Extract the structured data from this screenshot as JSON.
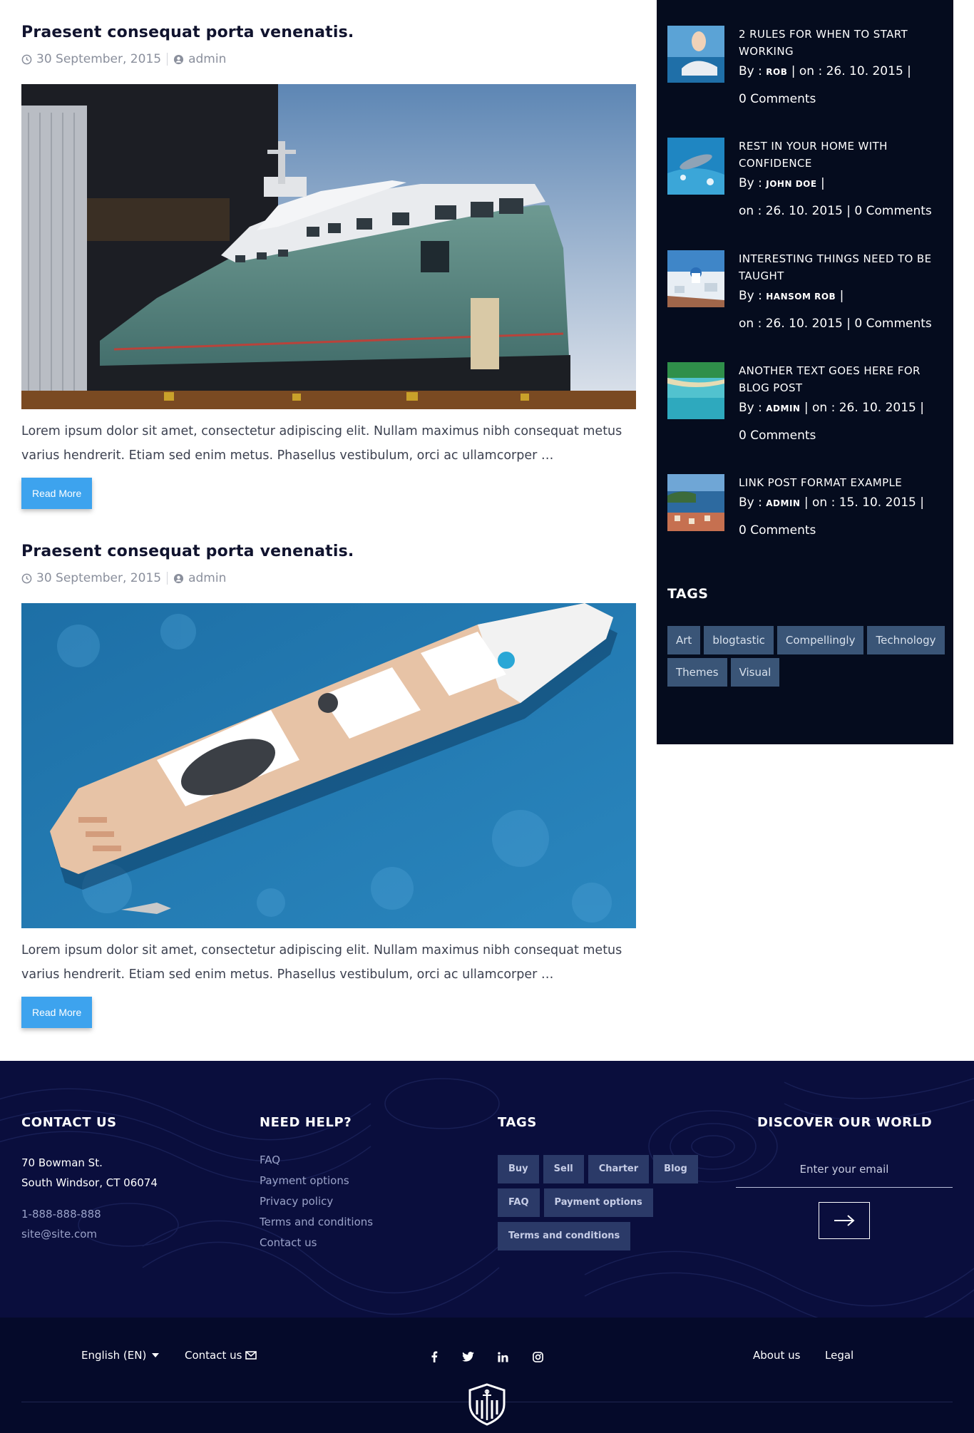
{
  "posts": [
    {
      "title": "Praesent consequat porta venenatis.",
      "date": "30 September, 2015",
      "author": "admin",
      "excerpt": "Lorem ipsum dolor sit amet, consectetur adipiscing elit. Nullam maximus nibh consequat metus varius hendrerit. Etiam sed enim metus. Phasellus vestibulum, orci ac ullamcorper …",
      "read_more": "Read More"
    },
    {
      "title": "Praesent consequat porta venenatis.",
      "date": "30 September, 2015",
      "author": "admin",
      "excerpt": "Lorem ipsum dolor sit amet, consectetur adipiscing elit. Nullam maximus nibh consequat metus varius hendrerit. Etiam sed enim metus. Phasellus vestibulum, orci ac ullamcorper …",
      "read_more": "Read More"
    }
  ],
  "sidebar": {
    "recent": [
      {
        "title": "2 RULES FOR WHEN TO START WORKING",
        "by": "By :",
        "author": "ROB",
        "on": "on : 26. 10. 2015",
        "comments": "0 Comments"
      },
      {
        "title": "REST IN YOUR HOME WITH CONFIDENCE",
        "by": "By :",
        "author": "JOHN DOE",
        "on": "on : 26. 10. 2015",
        "comments": "0 Comments"
      },
      {
        "title": "INTERESTING THINGS NEED TO BE TAUGHT",
        "by": "By :",
        "author": "HANSOM ROB",
        "on": "on : 26. 10. 2015",
        "comments": "0 Comments"
      },
      {
        "title": "ANOTHER TEXT GOES HERE FOR BLOG POST",
        "by": "By :",
        "author": "ADMIN",
        "on": "on : 26. 10. 2015",
        "comments": "0 Comments"
      },
      {
        "title": "LINK POST FORMAT EXAMPLE",
        "by": "By :",
        "author": "ADMIN",
        "on": "on : 15. 10. 2015",
        "comments": "0 Comments"
      }
    ],
    "tags_title": "TAGS",
    "tags": [
      "Art",
      "blogtastic",
      "Compellingly",
      "Technology",
      "Themes",
      "Visual"
    ]
  },
  "footer": {
    "contact": {
      "title": "CONTACT US",
      "address1": "70 Bowman St.",
      "address2": "South Windsor, CT 06074",
      "phone": "1-888-888-888",
      "email": "site@site.com"
    },
    "help": {
      "title": "NEED HELP?",
      "links": [
        "FAQ",
        "Payment options",
        "Privacy policy",
        "Terms and conditions",
        "Contact us"
      ]
    },
    "tags": {
      "title": "TAGS",
      "items": [
        "Buy",
        "Sell",
        "Charter",
        "Blog",
        "FAQ",
        "Payment options",
        "Terms and conditions"
      ]
    },
    "discover": {
      "title": "DISCOVER OUR WORLD",
      "email_placeholder": "Enter your email"
    },
    "bottom": {
      "language": "English (EN)",
      "contact": "Contact us",
      "about": "About us",
      "legal": "Legal"
    }
  },
  "colors": {
    "accent": "#3da3ee",
    "sidebar_bg": "#050c1e",
    "footer_bg": "#0a0e3d",
    "tag_bg": "#3a5577"
  }
}
